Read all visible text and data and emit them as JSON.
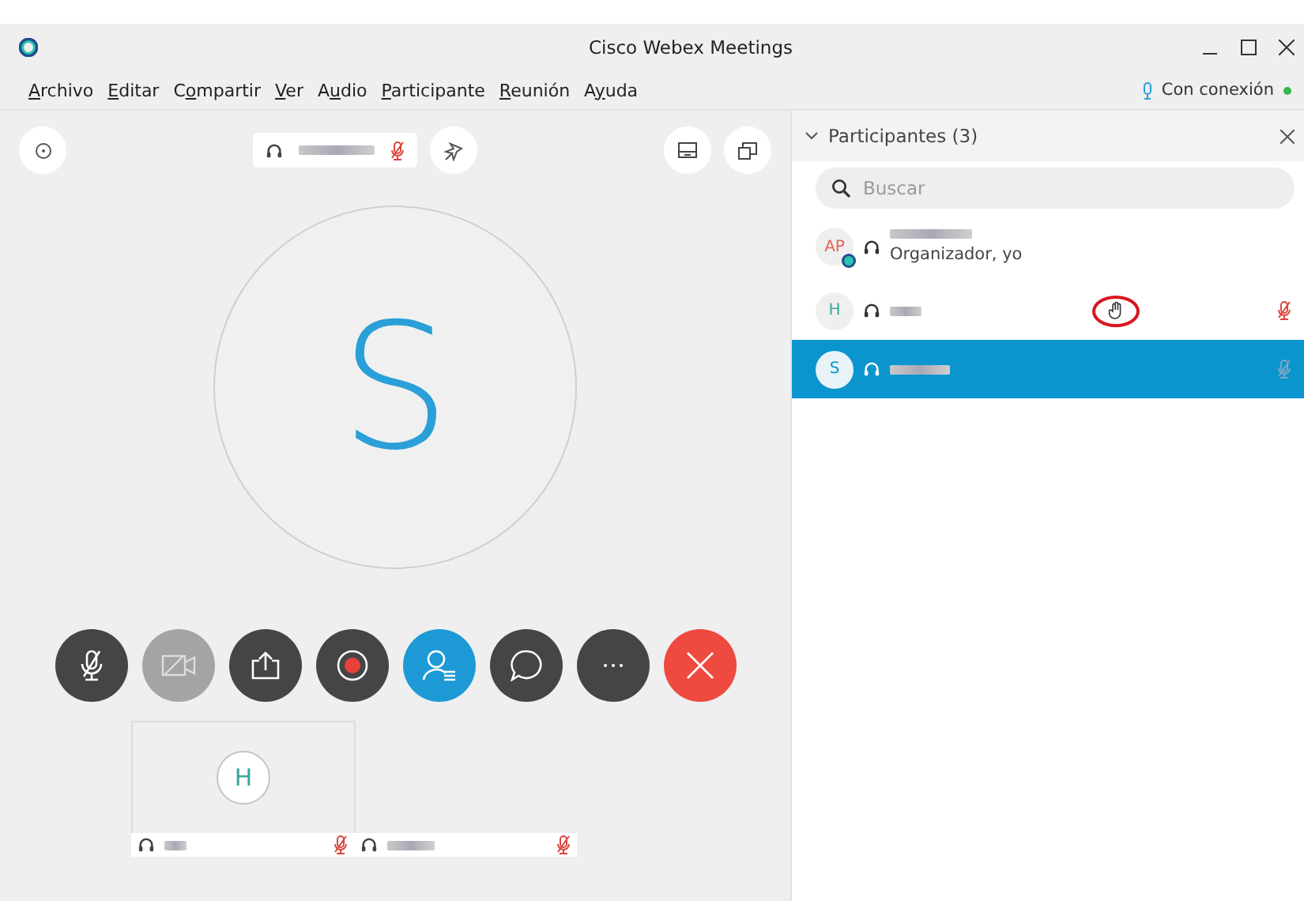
{
  "window": {
    "title": "Cisco Webex Meetings"
  },
  "menu": [
    {
      "key": "A",
      "rest": "rchivo"
    },
    {
      "key": "E",
      "rest": "ditar"
    },
    {
      "lead": "C",
      "key": "o",
      "rest": "mpartir"
    },
    {
      "key": "V",
      "rest": "er"
    },
    {
      "lead": "A",
      "key": "u",
      "rest": "dio"
    },
    {
      "key": "P",
      "rest": "articipante"
    },
    {
      "key": "R",
      "rest": "eunión"
    },
    {
      "lead": "A",
      "key": "y",
      "rest": "uda"
    }
  ],
  "connection": {
    "label": "Con conexión"
  },
  "stage": {
    "speaker_muted": true,
    "avatar_initial": "S"
  },
  "controls": [
    {
      "kind": "mute",
      "active": false,
      "disabled": false
    },
    {
      "kind": "video",
      "active": false,
      "disabled": true
    },
    {
      "kind": "share",
      "active": false,
      "disabled": false
    },
    {
      "kind": "record",
      "active": false,
      "disabled": false
    },
    {
      "kind": "participants",
      "active": true,
      "disabled": false
    },
    {
      "kind": "chat",
      "active": false,
      "disabled": false
    },
    {
      "kind": "more",
      "active": false,
      "disabled": false
    },
    {
      "kind": "end",
      "active": false,
      "disabled": false
    }
  ],
  "thumbnail": {
    "initial": "H"
  },
  "name_strips": [
    {
      "muted": true
    },
    {
      "muted": true
    }
  ],
  "panel": {
    "title": "Participantes (3)",
    "search": {
      "placeholder": "Buscar"
    },
    "participants": [
      {
        "initials": "AP",
        "host": true,
        "role": "Organizador, yo",
        "hand_raised": false,
        "muted": false,
        "selected": false
      },
      {
        "initials": "H",
        "host": false,
        "hand_raised": true,
        "muted": true,
        "selected": false
      },
      {
        "initials": "S",
        "host": false,
        "hand_raised": false,
        "muted": true,
        "selected": true
      }
    ]
  }
}
